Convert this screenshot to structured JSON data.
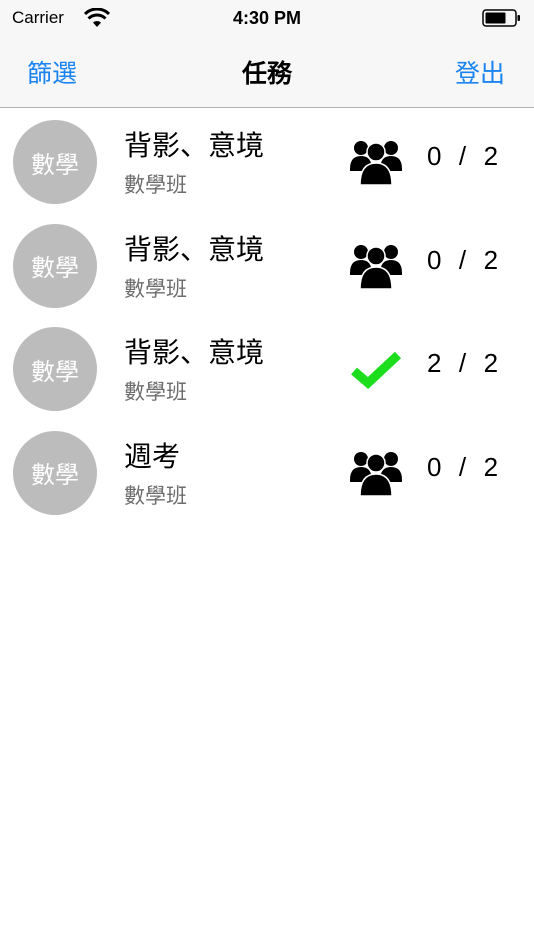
{
  "status_bar": {
    "carrier": "Carrier",
    "time": "4:30 PM"
  },
  "nav": {
    "left_label": "篩選",
    "title": "任務",
    "right_label": "登出"
  },
  "colors": {
    "accent": "#1a84f2",
    "check": "#1dde1d",
    "avatar": "#bcbcbc"
  },
  "tasks": [
    {
      "avatar": "數學",
      "title": "背影、意境",
      "subtitle": "數學班",
      "icon": "group-icon",
      "count": "0  /  2"
    },
    {
      "avatar": "數學",
      "title": "背影、意境",
      "subtitle": "數學班",
      "icon": "group-icon",
      "count": "0  /  2"
    },
    {
      "avatar": "數學",
      "title": "背影、意境",
      "subtitle": "數學班",
      "icon": "check-icon",
      "count": "2  /  2"
    },
    {
      "avatar": "數學",
      "title": "週考",
      "subtitle": "數學班",
      "icon": "group-icon",
      "count": "0  /  2"
    }
  ]
}
